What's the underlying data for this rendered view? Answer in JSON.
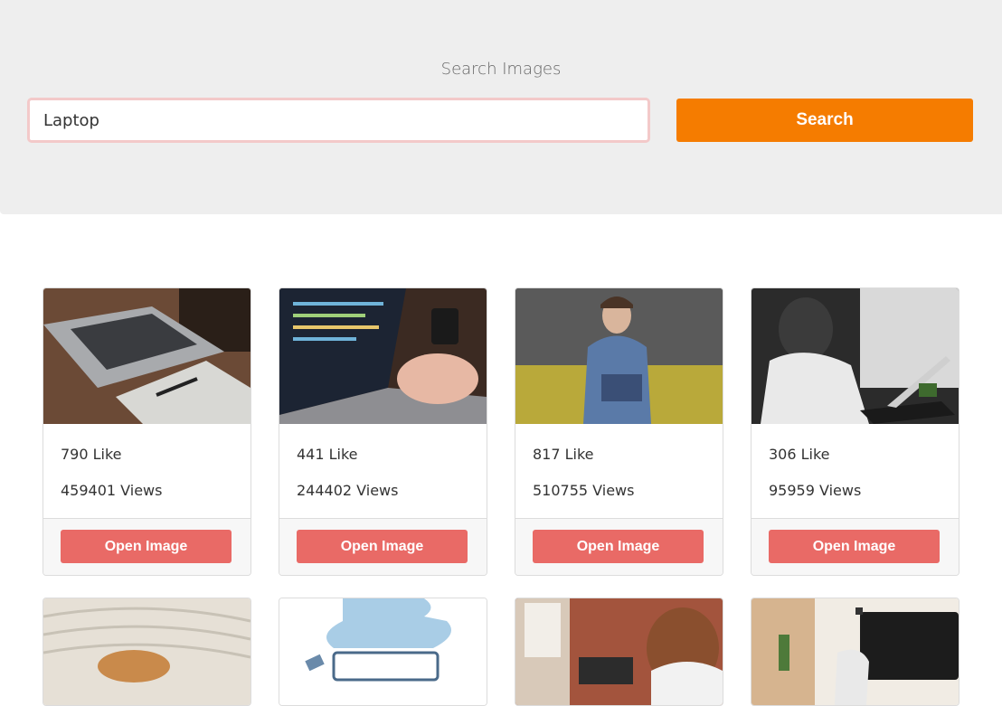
{
  "search": {
    "title": "Search Images",
    "value": "Laptop",
    "button_label": "Search"
  },
  "cards": [
    {
      "likes": "790 Like",
      "views": "459401 Views",
      "button": "Open Image"
    },
    {
      "likes": "441 Like",
      "views": "244402 Views",
      "button": "Open Image"
    },
    {
      "likes": "817 Like",
      "views": "510755 Views",
      "button": "Open Image"
    },
    {
      "likes": "306 Like",
      "views": "95959 Views",
      "button": "Open Image"
    }
  ],
  "colors": {
    "search_button": "#f57c00",
    "open_button": "#e96a66",
    "panel_background": "#eeeeee"
  }
}
